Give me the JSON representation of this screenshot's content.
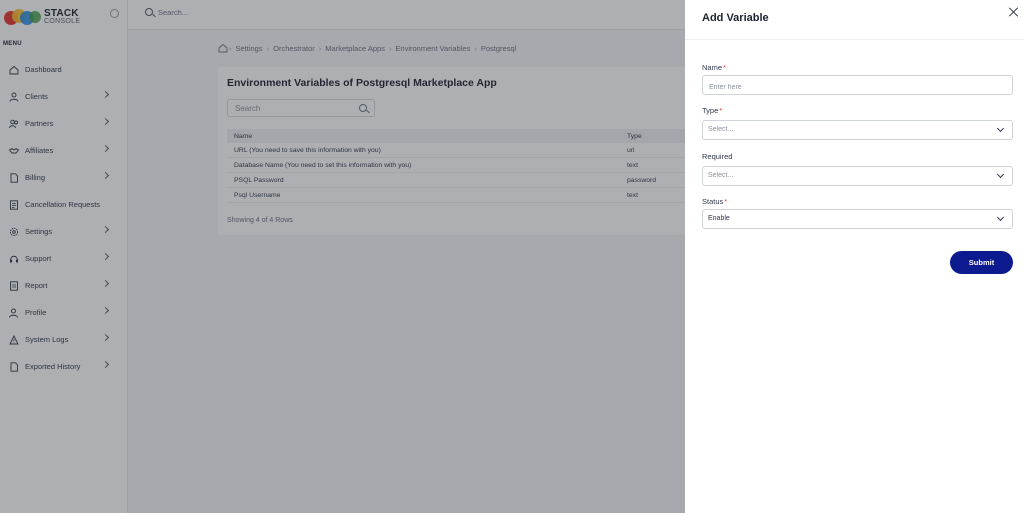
{
  "brand": {
    "name": "STACK",
    "subtitle": "CONSOLE"
  },
  "sidebar": {
    "menu_title": "MENU",
    "items": [
      {
        "label": "Dashboard",
        "icon": "home-icon",
        "has_children": false
      },
      {
        "label": "Clients",
        "icon": "user-icon",
        "has_children": true
      },
      {
        "label": "Partners",
        "icon": "users-icon",
        "has_children": true
      },
      {
        "label": "Affiliates",
        "icon": "handshake-icon",
        "has_children": true
      },
      {
        "label": "Billing",
        "icon": "file-icon",
        "has_children": true
      },
      {
        "label": "Cancellation Requests",
        "icon": "document-icon",
        "has_children": false
      },
      {
        "label": "Settings",
        "icon": "gear-icon",
        "has_children": true
      },
      {
        "label": "Support",
        "icon": "support-icon",
        "has_children": true
      },
      {
        "label": "Report",
        "icon": "report-icon",
        "has_children": true
      },
      {
        "label": "Profile",
        "icon": "profile-icon",
        "has_children": true
      },
      {
        "label": "System Logs",
        "icon": "logs-icon",
        "has_children": true
      },
      {
        "label": "Exported History",
        "icon": "export-icon",
        "has_children": true
      }
    ]
  },
  "topbar": {
    "search_placeholder": "Search..."
  },
  "breadcrumb": [
    "Settings",
    "Orchestrator",
    "Marketplace Apps",
    "Environment Variables",
    "Postgresql"
  ],
  "main": {
    "title": "Environment Variables of Postgresql Marketplace App",
    "search_placeholder": "Search",
    "table": {
      "headers": [
        "Name",
        "Type"
      ],
      "rows": [
        [
          "URL (You need to save this information with you)",
          "url"
        ],
        [
          "Database Name (You need to set this information with you)",
          "text"
        ],
        [
          "PSQL Password",
          "password"
        ],
        [
          "Psql Username",
          "text"
        ]
      ]
    },
    "footer": "Showing 4 of 4 Rows"
  },
  "drawer": {
    "title": "Add Variable",
    "fields": {
      "name": {
        "label": "Name",
        "required": "*",
        "placeholder": "Enter here"
      },
      "type": {
        "label": "Type",
        "required": "*",
        "value": "Select..."
      },
      "required": {
        "label": "Required",
        "value": "Select..."
      },
      "status": {
        "label": "Status",
        "required": "*",
        "value": "Enable"
      }
    },
    "submit_label": "Submit"
  },
  "colors": {
    "accent": "#0b1a8f",
    "required_mark": "#e53935",
    "overlay": "rgba(40,44,52,0.38)"
  }
}
